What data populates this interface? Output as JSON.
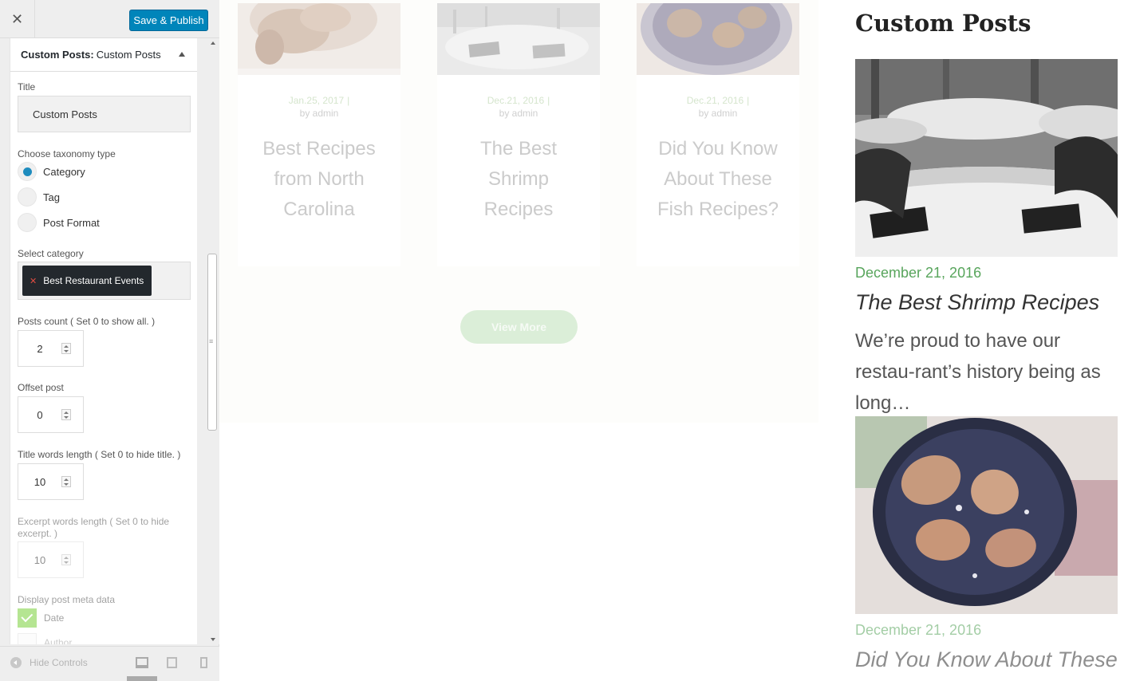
{
  "topbar": {
    "close_glyph": "✕",
    "publish_label": "Save & Publish"
  },
  "section": {
    "type_label": "Custom Posts:",
    "name": "Custom Posts"
  },
  "fields": {
    "title_label": "Title",
    "title_value": "Custom Posts",
    "taxonomy_label": "Choose taxonomy type",
    "taxonomy_options": [
      "Category",
      "Tag",
      "Post Format"
    ],
    "taxonomy_selected": "Category",
    "category_label": "Select category",
    "category_tag": "Best Restaurant Events",
    "posts_count_label": "Posts count ( Set 0 to show all. )",
    "posts_count": "2",
    "offset_label": "Offset post",
    "offset": "0",
    "title_len_label": "Title words length ( Set 0 to hide title. )",
    "title_len": "10",
    "excerpt_len_label": "Excerpt words length ( Set 0 to hide excerpt. )",
    "excerpt_len": "10",
    "meta_label": "Display post meta data",
    "meta_options": [
      "Date",
      "Author"
    ]
  },
  "footer": {
    "hide_controls": "Hide Controls"
  },
  "preview": {
    "cards": [
      {
        "date": "Jan.25, 2017",
        "author": "by admin",
        "title": "Best Recipes from North Carolina"
      },
      {
        "date": "Dec.21, 2016",
        "author": "by admin",
        "title": "The Best Shrimp Recipes"
      },
      {
        "date": "Dec.21, 2016",
        "author": "by admin",
        "title": "Did You Know About These Fish Recipes?"
      }
    ],
    "card_separator": "|",
    "view_more": "View More"
  },
  "widget": {
    "title": "Custom Posts",
    "posts": [
      {
        "date": "December 21, 2016",
        "title": "The Best Shrimp Recipes",
        "excerpt": "We’re proud to have our restau-rant’s history being as long…"
      },
      {
        "date": "December 21, 2016",
        "title": "Did You Know About These"
      }
    ]
  },
  "colors": {
    "accent_green": "#58a55c",
    "publish_blue": "#0085ba",
    "radio_blue": "#1e8cbe"
  },
  "icons": [
    "close-icon",
    "collapse-arrow-icon",
    "remove-x-icon",
    "spinner-icon",
    "check-icon",
    "hide-controls-icon",
    "desktop-icon",
    "tablet-icon",
    "mobile-icon"
  ]
}
